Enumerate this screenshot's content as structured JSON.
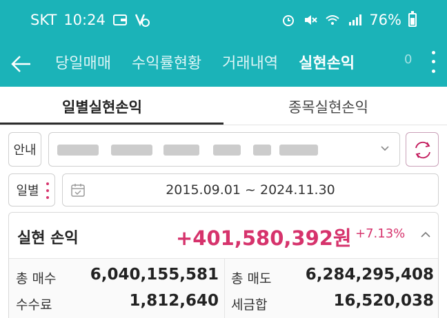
{
  "status_bar": {
    "carrier": "SKT",
    "time": "10:24",
    "battery": "76%"
  },
  "nav": {
    "tabs": [
      "당일매매",
      "수익률현황",
      "거래내역",
      "실현손익"
    ],
    "active_tab": "실현손익",
    "overflow_text": "0"
  },
  "subtabs": {
    "daily": "일별실현손익",
    "by_stock": "종목실현손익"
  },
  "account": {
    "guide_label": "안내"
  },
  "date_filter": {
    "mode_label": "일별",
    "range": "2015.09.01 ~ 2024.11.30"
  },
  "summary": {
    "label": "실현 손익",
    "amount": "+401,580,392원",
    "rate": "+7.13%",
    "total_buy_label": "총 매수",
    "total_buy": "6,040,155,581",
    "total_sell_label": "총 매도",
    "total_sell": "6,284,295,408",
    "fee_label": "수수료",
    "fee": "1,812,640",
    "tax_label": "세금합",
    "tax": "16,520,038"
  },
  "colors": {
    "header_bg": "#1bb3b8",
    "profit": "#d6336c"
  }
}
